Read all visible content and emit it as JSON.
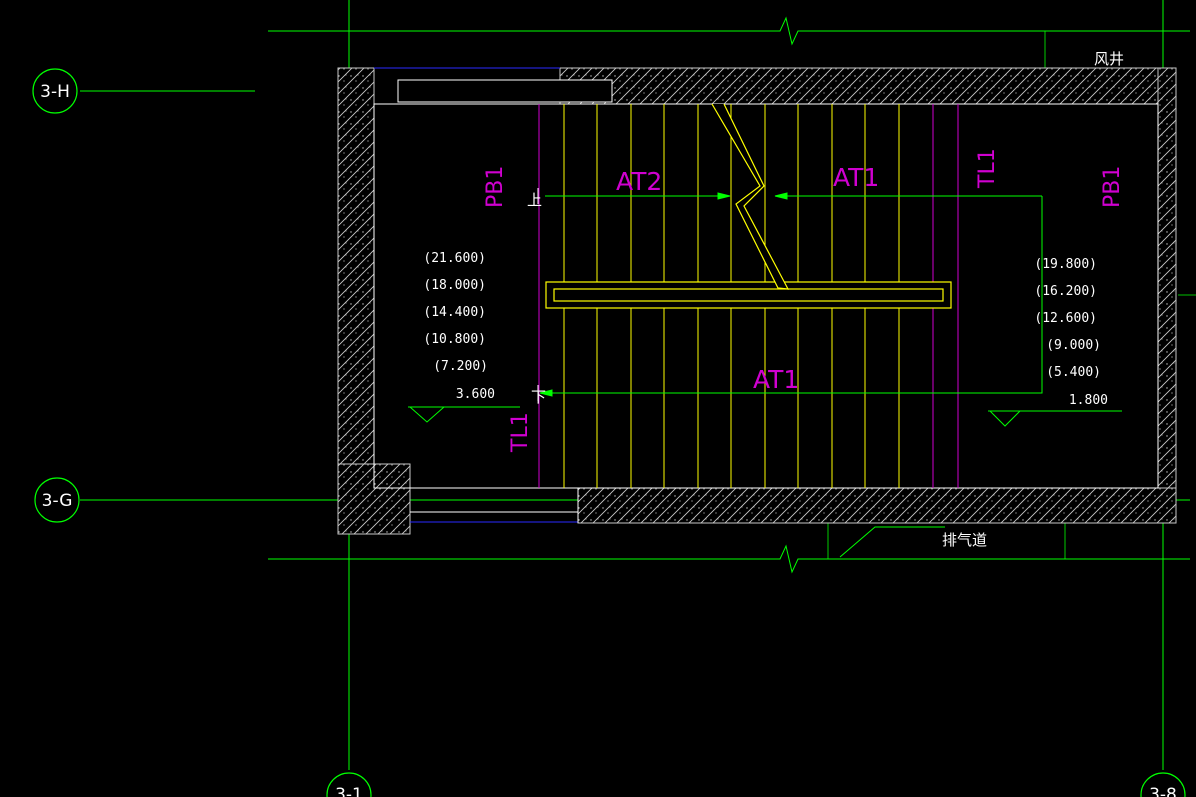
{
  "grid_axes": {
    "h": "3-H",
    "g": "3-G",
    "bottom_left": "3-1",
    "bottom_right": "3-8"
  },
  "labels": {
    "at2": "AT2",
    "at1_top": "AT1",
    "at1_bottom": "AT1",
    "pb1_left": "PB1",
    "pb1_right": "PB1",
    "tl1_top": "TL1",
    "tl1_bottom": "TL1",
    "up": "上",
    "down": "下",
    "wind_shaft": "风井",
    "exhaust_duct": "排气道"
  },
  "levels_left": [
    "(21.600)",
    "(18.000)",
    "(14.400)",
    "(10.800)",
    "(7.200)",
    "3.600"
  ],
  "levels_right": [
    "(19.800)",
    "(16.200)",
    "(12.600)",
    "(9.000)",
    "(5.400)",
    "1.800"
  ],
  "colors": {
    "background": "#000000",
    "grid_line": "#00ff00",
    "wall": "#c8c8c8",
    "stair_tread": "#ffff00",
    "annotation": "#d000d0",
    "text": "#ffffff",
    "thin_blue": "#0000ff"
  }
}
